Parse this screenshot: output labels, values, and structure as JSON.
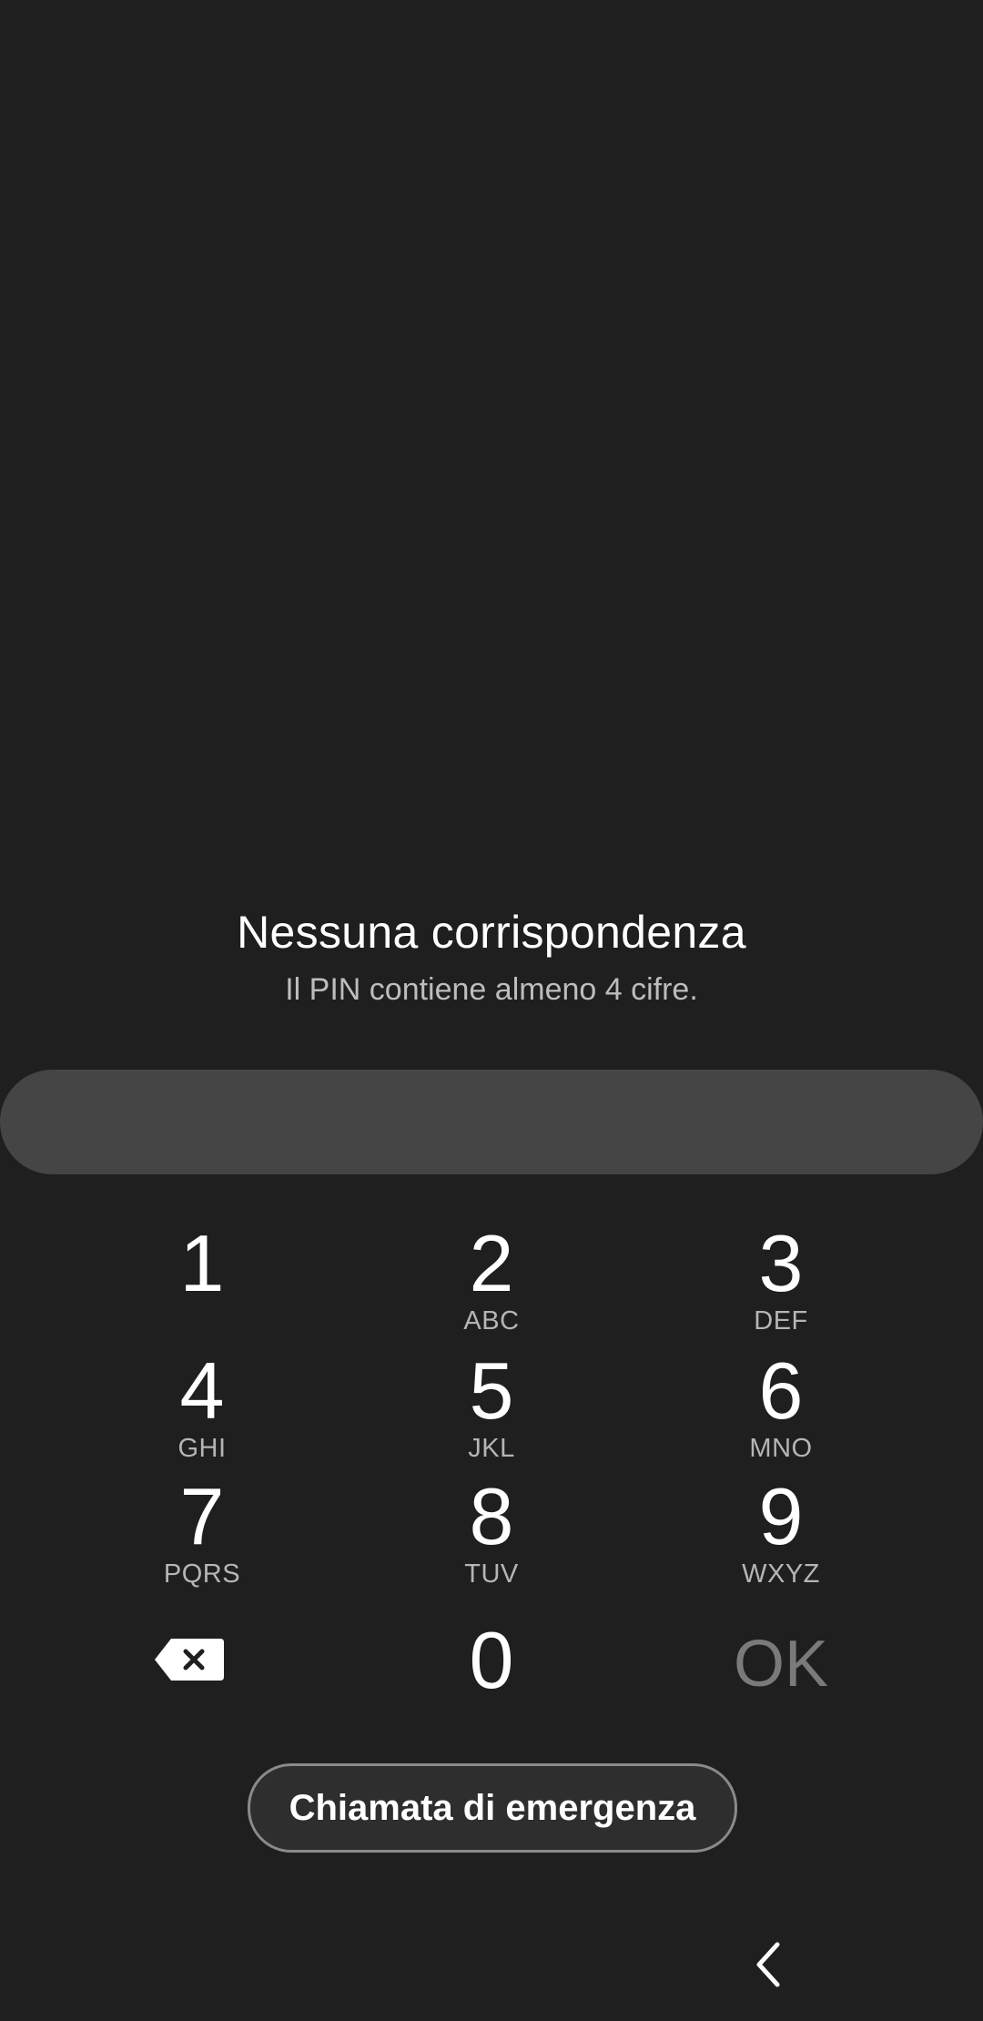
{
  "message": {
    "title": "Nessuna corrispondenza",
    "subtitle": "Il PIN contiene almeno 4 cifre."
  },
  "pin_input": {
    "value": ""
  },
  "keypad": {
    "keys": [
      {
        "digit": "1",
        "letters": ""
      },
      {
        "digit": "2",
        "letters": "ABC"
      },
      {
        "digit": "3",
        "letters": "DEF"
      },
      {
        "digit": "4",
        "letters": "GHI"
      },
      {
        "digit": "5",
        "letters": "JKL"
      },
      {
        "digit": "6",
        "letters": "MNO"
      },
      {
        "digit": "7",
        "letters": "PQRS"
      },
      {
        "digit": "8",
        "letters": "TUV"
      },
      {
        "digit": "9",
        "letters": "WXYZ"
      }
    ],
    "zero": {
      "digit": "0"
    },
    "ok_label": "OK",
    "backspace_icon": "backspace-icon"
  },
  "emergency": {
    "label": "Chiamata di emergenza"
  },
  "navigation": {
    "back_icon": "chevron-left-icon"
  },
  "colors": {
    "background": "#1f1f1f",
    "pin_field": "#454545",
    "ok_disabled": "#7a7a7a"
  }
}
